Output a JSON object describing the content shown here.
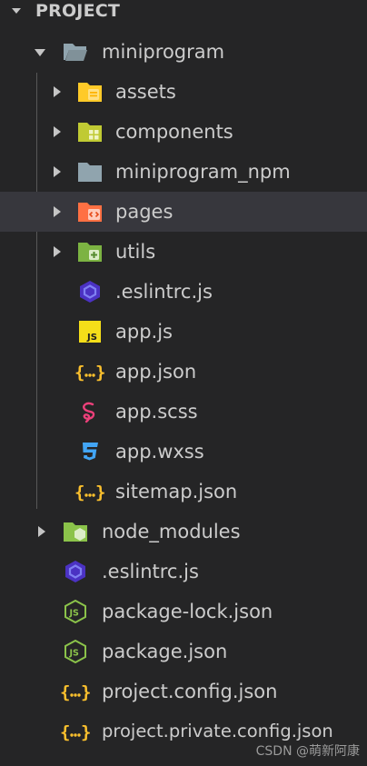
{
  "explorer": {
    "section_title": "PROJECT"
  },
  "tree": [
    {
      "label": "miniprogram",
      "icon": "folder-open-icon"
    },
    {
      "label": "assets",
      "icon": "folder-assets-icon"
    },
    {
      "label": "components",
      "icon": "folder-components-icon"
    },
    {
      "label": "miniprogram_npm",
      "icon": "folder-icon"
    },
    {
      "label": "pages",
      "icon": "folder-pages-icon"
    },
    {
      "label": "utils",
      "icon": "folder-utils-icon"
    },
    {
      "label": ".eslintrc.js",
      "icon": "eslint-icon"
    },
    {
      "label": "app.js",
      "icon": "javascript-icon"
    },
    {
      "label": "app.json",
      "icon": "json-icon"
    },
    {
      "label": "app.scss",
      "icon": "sass-icon"
    },
    {
      "label": "app.wxss",
      "icon": "css-icon"
    },
    {
      "label": "sitemap.json",
      "icon": "json-icon"
    },
    {
      "label": "node_modules",
      "icon": "folder-node-icon"
    },
    {
      "label": ".eslintrc.js",
      "icon": "eslint-icon"
    },
    {
      "label": "package-lock.json",
      "icon": "nodejs-icon"
    },
    {
      "label": "package.json",
      "icon": "nodejs-icon"
    },
    {
      "label": "project.config.json",
      "icon": "json-icon"
    },
    {
      "label": "project.private.config.json",
      "icon": "json-icon"
    }
  ],
  "watermark": "CSDN @萌新阿康",
  "colors": {
    "background": "#252526",
    "selected_row": "#37373d",
    "text": "#cccccc",
    "folder_gray": "#90a4ae",
    "folder_assets": "#ffca28",
    "folder_components": "#c0ca33",
    "folder_pages": "#ff7043",
    "folder_utils": "#7cb342",
    "folder_node": "#8bc34a",
    "eslint": "#4b32c3",
    "js": "#f5de19",
    "json": "#fbc02d",
    "sass": "#ec407a",
    "css": "#42a5f5",
    "nodejs": "#8bc34a"
  }
}
